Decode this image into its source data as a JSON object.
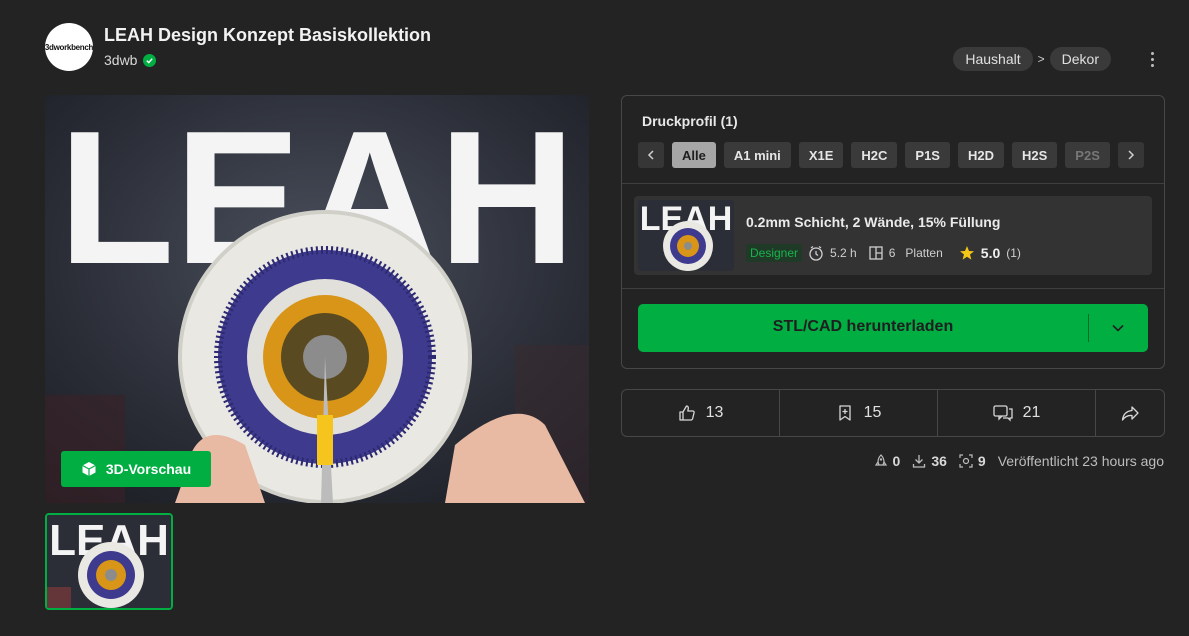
{
  "header": {
    "avatar_text": "3dworkbench",
    "title": "LEAH Design Konzept Basiskollektion",
    "author": "3dwb",
    "breadcrumb": [
      "Haushalt",
      "Dekor"
    ],
    "breadcrumb_separator": ">"
  },
  "gallery": {
    "hero_text": "LEAH",
    "preview_button": "3D-Vorschau"
  },
  "print_profile": {
    "title": "Druckprofil (1)",
    "tabs": [
      "Alle",
      "A1 mini",
      "X1E",
      "H2C",
      "P1S",
      "H2D",
      "H2S",
      "P2S"
    ],
    "active_tab": "Alle",
    "profile": {
      "name": "0.2mm Schicht, 2 Wände, 15% Füllung",
      "badge": "Designer",
      "time": "5.2 h",
      "plates_count": "6",
      "plates_label": "Platten",
      "rating": "5.0",
      "rating_count": "(1)"
    },
    "download_label": "STL/CAD herunterladen"
  },
  "actions": {
    "likes": "13",
    "collects": "15",
    "comments": "21"
  },
  "stats": {
    "boosts": "0",
    "downloads": "36",
    "prints": "9",
    "published": "Veröffentlicht 23 hours ago"
  },
  "colors": {
    "accent": "#00ae42",
    "background": "#232323",
    "panel_border": "#474747",
    "star": "#f5c518"
  }
}
